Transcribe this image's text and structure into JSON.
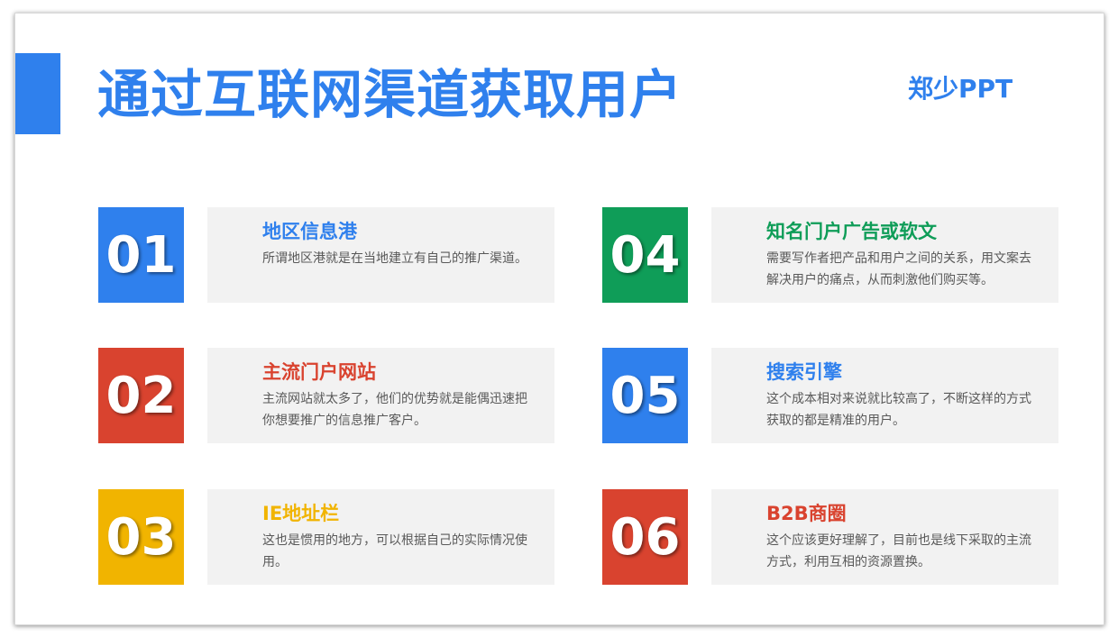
{
  "title": "通过互联网渠道获取用户",
  "brand": "郑少PPT",
  "colors": {
    "blue": "#2f80ed",
    "red": "#d9432f",
    "yellow": "#f1b400",
    "green": "#0f9d58",
    "card_bg": "#f2f2f2"
  },
  "items": [
    {
      "num": "01",
      "title": "地区信息港",
      "text": "所谓地区港就是在当地建立有自己的推广渠道。",
      "color": "#2f80ed"
    },
    {
      "num": "02",
      "title": "主流门户网站",
      "text": "主流网站就太多了，他们的优势就是能偶迅速把你想要推广的信息推广客户。",
      "color": "#d9432f"
    },
    {
      "num": "03",
      "title": "IE地址栏",
      "text": "这也是惯用的地方，可以根据自己的实际情况使用。",
      "color": "#f1b400"
    },
    {
      "num": "04",
      "title": "知名门户广告或软文",
      "text": "需要写作者把产品和用户之间的关系，用文案去解决用户的痛点，从而刺激他们购买等。",
      "color": "#0f9d58"
    },
    {
      "num": "05",
      "title": "搜索引擎",
      "text": "这个成本相对来说就比较高了，不断这样的方式获取的都是精准的用户。",
      "color": "#2f80ed"
    },
    {
      "num": "06",
      "title": "B2B商圈",
      "text": "这个应该更好理解了，目前也是线下采取的主流方式，利用互相的资源置换。",
      "color": "#d9432f"
    }
  ]
}
